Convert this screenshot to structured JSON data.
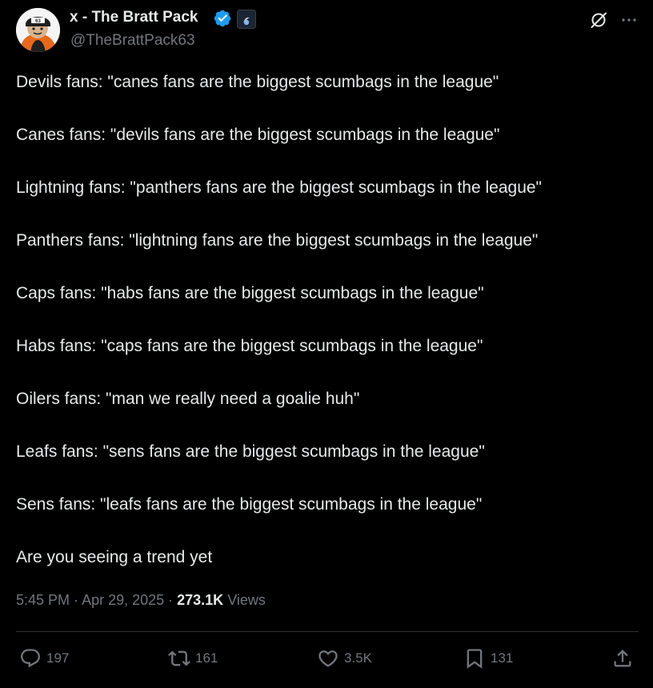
{
  "header": {
    "display_name": "x - The Bratt Pack",
    "handle": "@TheBrattPack63",
    "avatar_text": "63"
  },
  "tweet": {
    "lines": [
      "Devils fans: \"canes fans are the biggest scumbags in the league\"",
      "Canes fans: \"devils fans are the biggest scumbags in the league\"",
      "Lightning fans: \"panthers fans are the biggest scumbags in the league\"",
      "Panthers fans: \"lightning fans are the biggest scumbags in the league\"",
      "Caps fans: \"habs fans are the biggest scumbags in the league\"",
      "Habs fans: \"caps fans are the biggest scumbags in the league\"",
      "Oilers fans: \"man we really need a goalie huh\"",
      "Leafs fans: \"sens fans are the biggest scumbags in the league\"",
      "Sens fans: \"leafs fans are the biggest scumbags in the league\"",
      "Are you seeing a trend yet"
    ]
  },
  "meta": {
    "time": "5:45 PM",
    "date": "Apr 29, 2025",
    "separator": " · ",
    "views_count": "273.1K",
    "views_label": "Views"
  },
  "actions": {
    "replies": "197",
    "reposts": "161",
    "likes": "3.5K",
    "bookmarks": "131"
  },
  "icons": [
    "verified-badge-icon",
    "affiliate-badge-icon",
    "grok-icon",
    "more-icon",
    "reply-icon",
    "repost-icon",
    "like-icon",
    "bookmark-icon",
    "share-icon"
  ],
  "colors": {
    "background": "#000000",
    "text": "#e7e9ea",
    "secondary": "#71767b",
    "verified": "#1d9bf0",
    "divider": "#2f3336"
  }
}
